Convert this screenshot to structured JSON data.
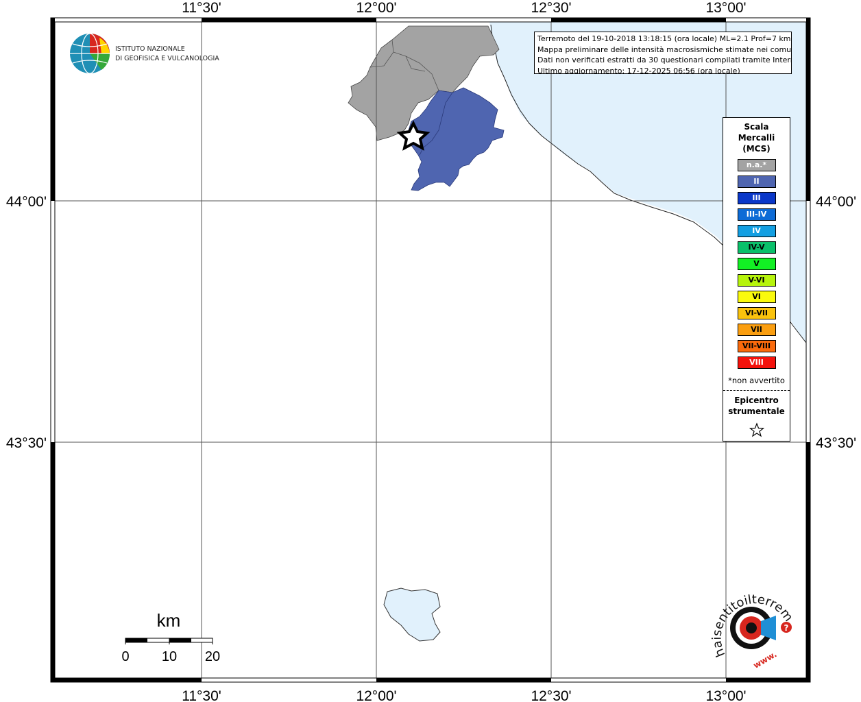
{
  "map": {
    "axis_labels": {
      "lon": [
        "11°30'",
        "12°00'",
        "12°30'",
        "13°00'"
      ],
      "lat": [
        "44°00'",
        "43°30'"
      ]
    },
    "info": {
      "line1": "Terremoto del 19-10-2018 13:18:15 (ora locale) ML=2.1 Prof=7 km",
      "line2": "Mappa preliminare delle intensità macrosismiche stimate nei comuni",
      "line3": "Dati non verificati estratti da 30 questionari compilati tramite Internet.",
      "line4": "Ultimo aggiornamento: 17-12-2025 06:56 (ora locale)"
    },
    "institute": {
      "name_line1": "ISTITUTO NAZIONALE",
      "name_line2": "DI GEOFISICA E VULCANOLOGIA"
    },
    "scale_bar": {
      "unit": "km",
      "labels": [
        "0",
        "10",
        "20"
      ]
    },
    "hsit_logo": {
      "text": "haisentitoilterremoto.it",
      "url_text": "www."
    },
    "colors": {
      "sea": "#e1f1fc",
      "not_felt": "#a3a3a3",
      "intensity_II": "#4f65b0"
    }
  },
  "legend": {
    "title_line1": "Scala",
    "title_line2": "Mercalli",
    "title_line3": "(MCS)",
    "items": [
      {
        "label": "n.a.*",
        "color": "#a3a3a3",
        "text_color": "#ffffff"
      },
      {
        "label": "II",
        "color": "#4f65b0",
        "text_color": "#ffffff"
      },
      {
        "label": "III",
        "color": "#0a37c9",
        "text_color": "#ffffff"
      },
      {
        "label": "III-IV",
        "color": "#0d6bd6",
        "text_color": "#ffffff"
      },
      {
        "label": "IV",
        "color": "#139fe2",
        "text_color": "#ffffff"
      },
      {
        "label": "IV-V",
        "color": "#0ac06a",
        "text_color": "#000000"
      },
      {
        "label": "V",
        "color": "#12f024",
        "text_color": "#000000"
      },
      {
        "label": "V-VI",
        "color": "#b6f40c",
        "text_color": "#000000"
      },
      {
        "label": "VI",
        "color": "#fafa0d",
        "text_color": "#000000"
      },
      {
        "label": "VI-VII",
        "color": "#fac30d",
        "text_color": "#000000"
      },
      {
        "label": "VII",
        "color": "#fa9e10",
        "text_color": "#000000"
      },
      {
        "label": "VII-VIII",
        "color": "#fa6a0c",
        "text_color": "#000000"
      },
      {
        "label": "VIII",
        "color": "#f4120c",
        "text_color": "#ffffff"
      }
    ],
    "note": "*non avvertito",
    "epicenter_line1": "Epicentro",
    "epicenter_line2": "strumentale"
  }
}
